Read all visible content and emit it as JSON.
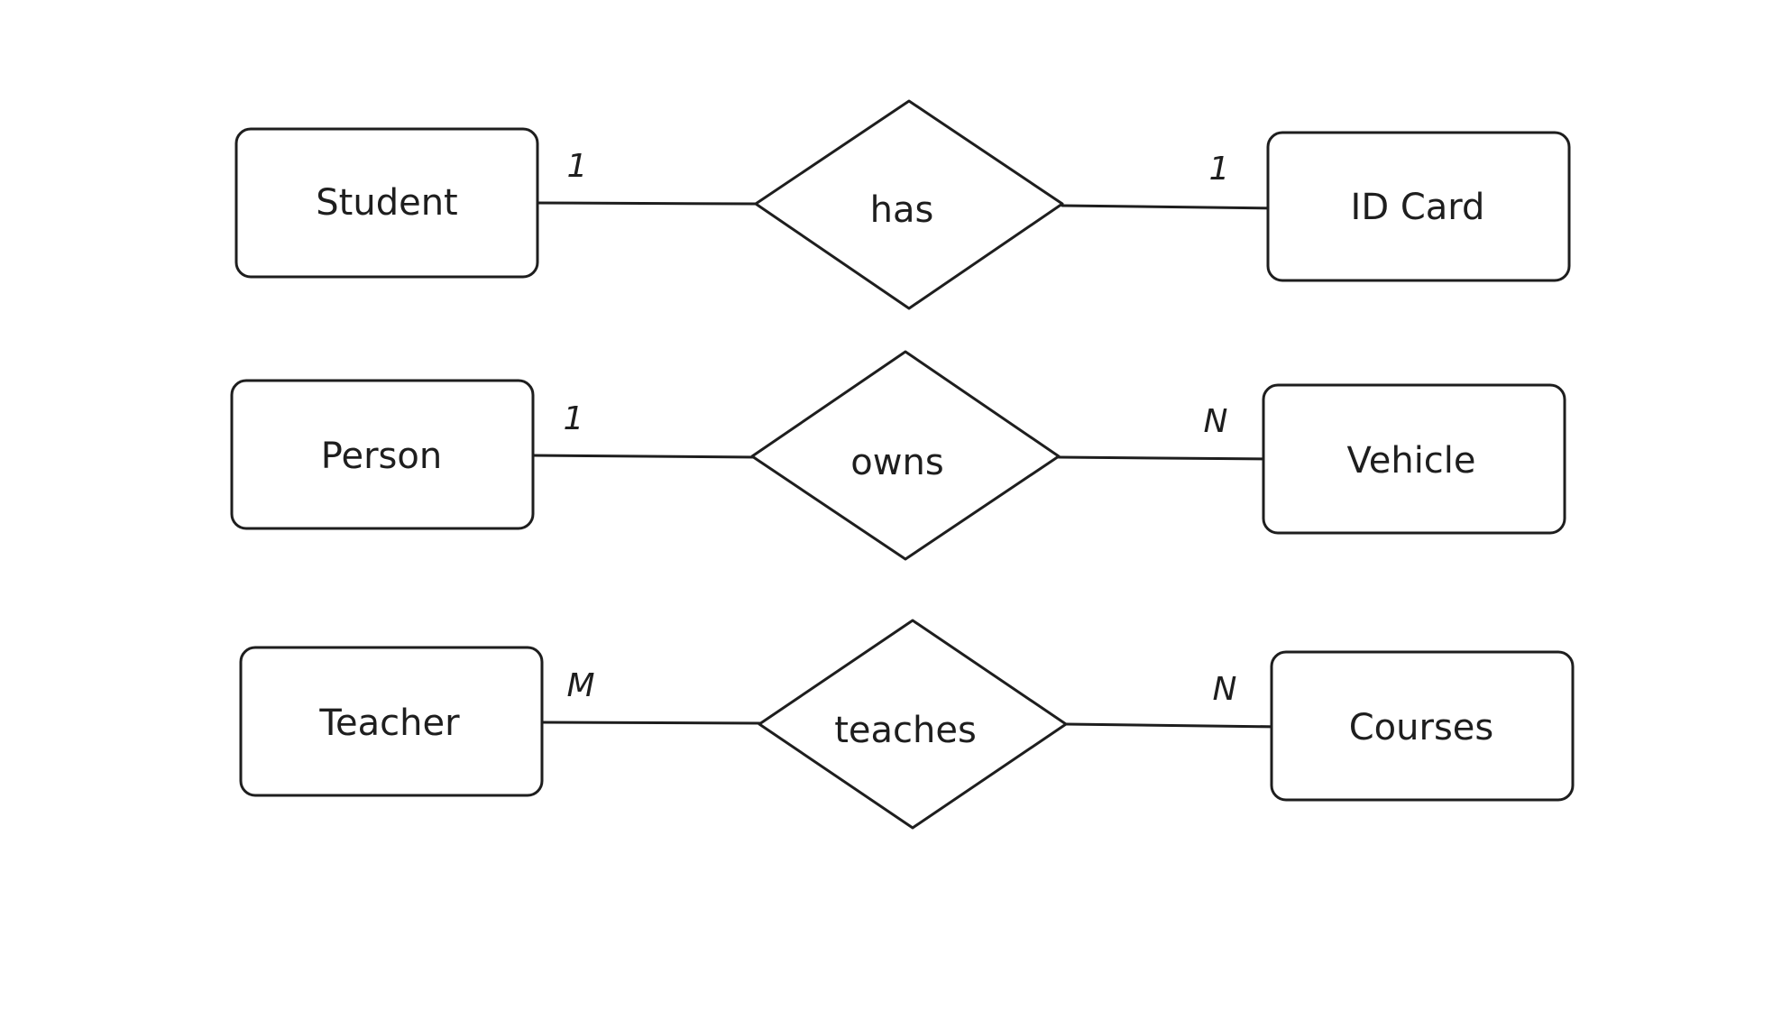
{
  "diagram": {
    "type": "entity-relationship",
    "stroke_color": "#1e1e1e",
    "background_color": "#ffffff",
    "rows": [
      {
        "left_entity": "Student",
        "relationship": "has",
        "right_entity": "ID Card",
        "left_cardinality": "1",
        "right_cardinality": "1"
      },
      {
        "left_entity": "Person",
        "relationship": "owns",
        "right_entity": "Vehicle",
        "left_cardinality": "1",
        "right_cardinality": "N"
      },
      {
        "left_entity": "Teacher",
        "relationship": "teaches",
        "right_entity": "Courses",
        "left_cardinality": "M",
        "right_cardinality": "N"
      }
    ]
  }
}
